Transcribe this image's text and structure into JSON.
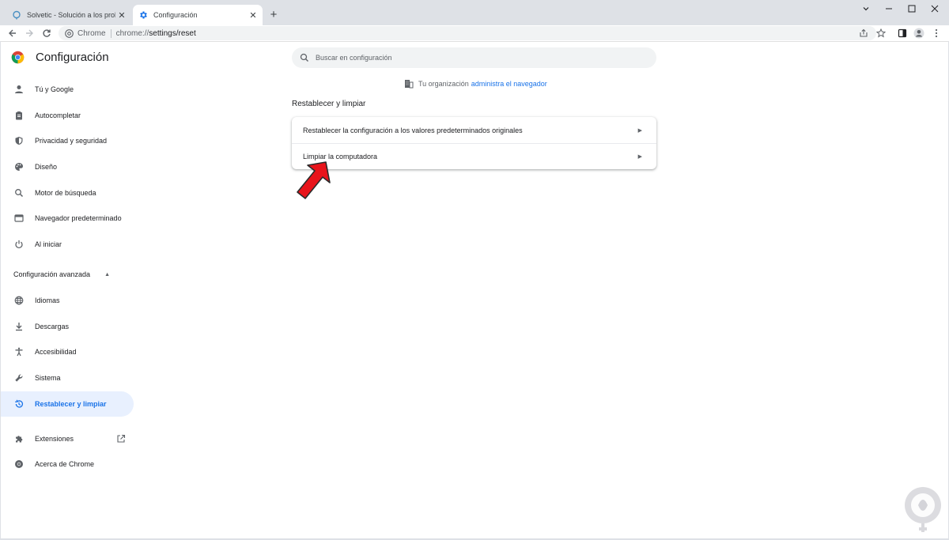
{
  "tabs": [
    {
      "title": "Solvetic - Solución a los problem",
      "active": false,
      "favicon": "solvetic-icon"
    },
    {
      "title": "Configuración",
      "active": true,
      "favicon": "gear-icon"
    }
  ],
  "omnibox": {
    "chip": "Chrome",
    "scheme": "chrome://",
    "path": "settings/reset"
  },
  "header": {
    "title": "Configuración"
  },
  "search": {
    "placeholder": "Buscar en configuración"
  },
  "nav": {
    "items": [
      {
        "label": "Tú y Google",
        "icon": "person-icon"
      },
      {
        "label": "Autocompletar",
        "icon": "clipboard-icon"
      },
      {
        "label": "Privacidad y seguridad",
        "icon": "shield-icon"
      },
      {
        "label": "Diseño",
        "icon": "palette-icon"
      },
      {
        "label": "Motor de búsqueda",
        "icon": "search-icon"
      },
      {
        "label": "Navegador predeterminado",
        "icon": "browser-icon"
      },
      {
        "label": "Al iniciar",
        "icon": "power-icon"
      }
    ],
    "advanced_label": "Configuración avanzada",
    "advanced_items": [
      {
        "label": "Idiomas",
        "icon": "globe-icon"
      },
      {
        "label": "Descargas",
        "icon": "download-icon"
      },
      {
        "label": "Accesibilidad",
        "icon": "accessibility-icon"
      },
      {
        "label": "Sistema",
        "icon": "wrench-icon"
      },
      {
        "label": "Restablecer y limpiar",
        "icon": "restore-icon",
        "selected": true
      }
    ],
    "extensions_label": "Extensiones",
    "about_label": "Acerca de Chrome"
  },
  "managed": {
    "prefix": "Tu organización",
    "link": "administra el navegador"
  },
  "section": {
    "title": "Restablecer y limpiar",
    "rows": [
      {
        "label": "Restablecer la configuración a los valores predeterminados originales"
      },
      {
        "label": "Limpiar la computadora"
      }
    ]
  },
  "colors": {
    "accent": "#1a73e8",
    "selected_bg": "#e8f0fe",
    "annotation_arrow": "#e8141b"
  }
}
